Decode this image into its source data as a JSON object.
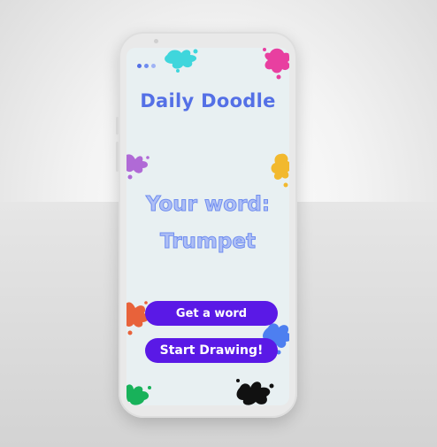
{
  "app": {
    "title": "Daily Doodle",
    "word_label": "Your word:",
    "word_value": "Trumpet"
  },
  "buttons": {
    "get_word": "Get a word",
    "start_drawing": "Start Drawing!"
  },
  "colors": {
    "title": "#5470e6",
    "word_fill": "#aebff5",
    "button": "#5a19e6",
    "screen_bg": "#e8f0f2"
  },
  "decorations": {
    "splats": [
      "cyan",
      "magenta",
      "purple",
      "yellow",
      "orange",
      "blue",
      "green",
      "black"
    ],
    "page_indicator_dots": 3
  }
}
